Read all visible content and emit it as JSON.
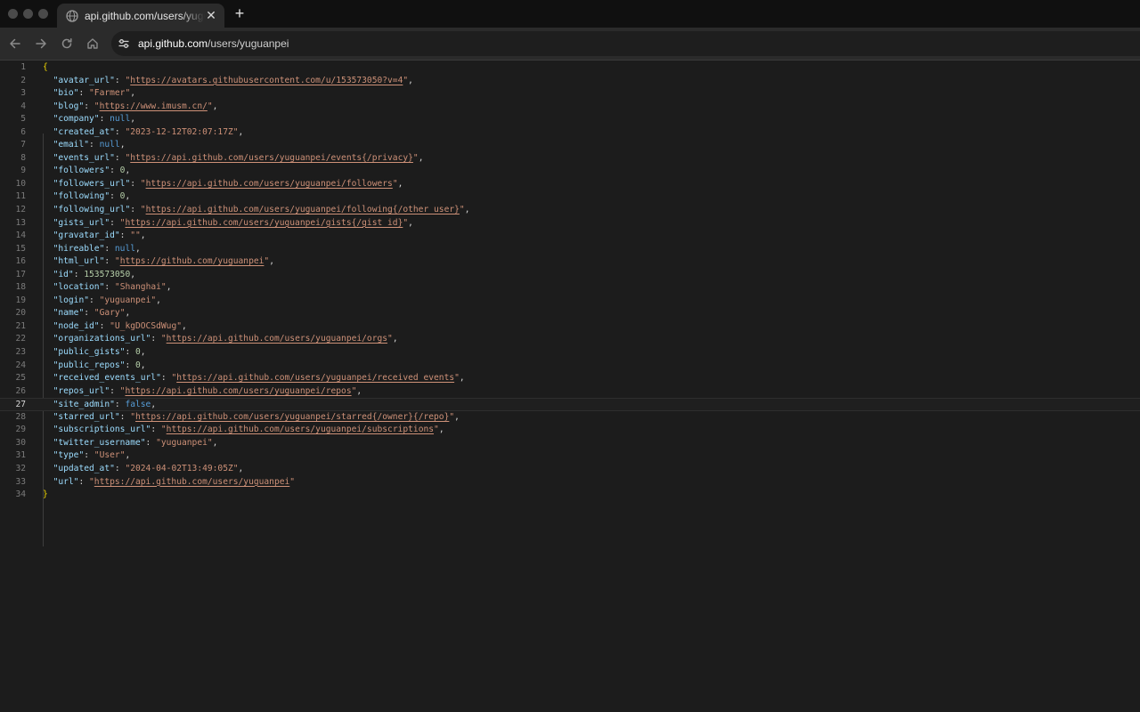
{
  "browser": {
    "tab_title": "api.github.com/users/yuguanpei",
    "tab_close_icon": "close-icon",
    "new_tab_label": "+",
    "address_host": "api.github.com",
    "address_path": "/users/yuguanpei"
  },
  "colors": {
    "key": "#9cdcfe",
    "string": "#ce9178",
    "number": "#b5cea8",
    "keyword": "#569cd6",
    "brace": "#f1d700",
    "background": "#1c1c1c"
  },
  "json_lines": [
    {
      "n": "1",
      "open": "{"
    },
    {
      "n": "2",
      "key": "avatar_url",
      "type": "url",
      "value": "https://avatars.githubusercontent.com/u/153573050?v=4",
      "comma": true
    },
    {
      "n": "3",
      "key": "bio",
      "type": "string",
      "value": "Farmer",
      "comma": true
    },
    {
      "n": "4",
      "key": "blog",
      "type": "url",
      "value": "https://www.imusm.cn/",
      "comma": true
    },
    {
      "n": "5",
      "key": "company",
      "type": "keyword",
      "value": "null",
      "comma": true
    },
    {
      "n": "6",
      "key": "created_at",
      "type": "string",
      "value": "2023-12-12T02:07:17Z",
      "comma": true
    },
    {
      "n": "7",
      "key": "email",
      "type": "keyword",
      "value": "null",
      "comma": true
    },
    {
      "n": "8",
      "key": "events_url",
      "type": "url",
      "value": "https://api.github.com/users/yuguanpei/events{/privacy}",
      "comma": true
    },
    {
      "n": "9",
      "key": "followers",
      "type": "number",
      "value": "0",
      "comma": true
    },
    {
      "n": "10",
      "key": "followers_url",
      "type": "url",
      "value": "https://api.github.com/users/yuguanpei/followers",
      "comma": true
    },
    {
      "n": "11",
      "key": "following",
      "type": "number",
      "value": "0",
      "comma": true
    },
    {
      "n": "12",
      "key": "following_url",
      "type": "url",
      "value": "https://api.github.com/users/yuguanpei/following{/other_user}",
      "comma": true
    },
    {
      "n": "13",
      "key": "gists_url",
      "type": "url",
      "value": "https://api.github.com/users/yuguanpei/gists{/gist_id}",
      "comma": true
    },
    {
      "n": "14",
      "key": "gravatar_id",
      "type": "string",
      "value": "",
      "comma": true
    },
    {
      "n": "15",
      "key": "hireable",
      "type": "keyword",
      "value": "null",
      "comma": true
    },
    {
      "n": "16",
      "key": "html_url",
      "type": "url",
      "value": "https://github.com/yuguanpei",
      "comma": true
    },
    {
      "n": "17",
      "key": "id",
      "type": "number",
      "value": "153573050",
      "comma": true
    },
    {
      "n": "18",
      "key": "location",
      "type": "string",
      "value": "Shanghai",
      "comma": true
    },
    {
      "n": "19",
      "key": "login",
      "type": "string",
      "value": "yuguanpei",
      "comma": true
    },
    {
      "n": "20",
      "key": "name",
      "type": "string",
      "value": "Gary",
      "comma": true
    },
    {
      "n": "21",
      "key": "node_id",
      "type": "string",
      "value": "U_kgDOCSdWug",
      "comma": true
    },
    {
      "n": "22",
      "key": "organizations_url",
      "type": "url",
      "value": "https://api.github.com/users/yuguanpei/orgs",
      "comma": true
    },
    {
      "n": "23",
      "key": "public_gists",
      "type": "number",
      "value": "0",
      "comma": true
    },
    {
      "n": "24",
      "key": "public_repos",
      "type": "number",
      "value": "0",
      "comma": true
    },
    {
      "n": "25",
      "key": "received_events_url",
      "type": "url",
      "value": "https://api.github.com/users/yuguanpei/received_events",
      "comma": true
    },
    {
      "n": "26",
      "key": "repos_url",
      "type": "url",
      "value": "https://api.github.com/users/yuguanpei/repos",
      "comma": true
    },
    {
      "n": "27",
      "key": "site_admin",
      "type": "keyword",
      "value": "false",
      "comma": true,
      "active": true
    },
    {
      "n": "28",
      "key": "starred_url",
      "type": "url",
      "value": "https://api.github.com/users/yuguanpei/starred{/owner}{/repo}",
      "comma": true
    },
    {
      "n": "29",
      "key": "subscriptions_url",
      "type": "url",
      "value": "https://api.github.com/users/yuguanpei/subscriptions",
      "comma": true
    },
    {
      "n": "30",
      "key": "twitter_username",
      "type": "string",
      "value": "yuguanpei",
      "comma": true
    },
    {
      "n": "31",
      "key": "type",
      "type": "string",
      "value": "User",
      "comma": true
    },
    {
      "n": "32",
      "key": "updated_at",
      "type": "string",
      "value": "2024-04-02T13:49:05Z",
      "comma": true
    },
    {
      "n": "33",
      "key": "url",
      "type": "url",
      "value": "https://api.github.com/users/yuguanpei",
      "comma": false
    },
    {
      "n": "34",
      "close": "}"
    }
  ]
}
